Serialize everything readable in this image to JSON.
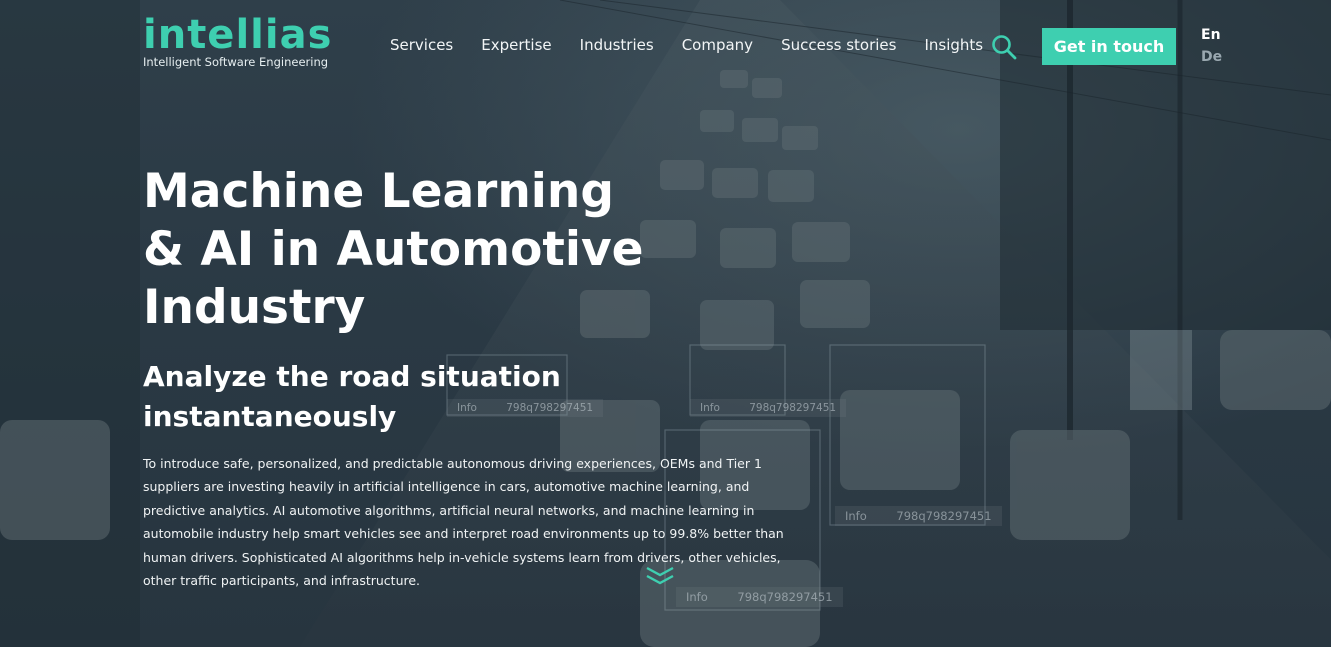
{
  "header": {
    "logo_word": "intellias",
    "logo_tagline": "Intelligent Software Engineering",
    "nav": [
      "Services",
      "Expertise",
      "Industries",
      "Company",
      "Success stories",
      "Insights"
    ],
    "search_icon": "search-icon",
    "cta_label": "Get in touch",
    "languages": {
      "active": "En",
      "inactive": "De"
    }
  },
  "hero": {
    "title_lines": [
      "Machine Learning",
      "& AI in Automotive",
      "Industry"
    ],
    "subtitle_lines": [
      "Analyze the road situation",
      "instantaneously"
    ],
    "body": "To introduce safe, personalized, and predictable autonomous driving experiences, OEMs and Tier 1 suppliers are investing heavily in artificial intelligence in cars, automotive machine learning, and predictive analytics. AI automotive algorithms, artificial neural networks, and machine learning in automobile industry help smart vehicles see and interpret road environments up to 99.8% better than human drivers. Sophisticated AI algorithms help in-vehicle systems learn from drivers, other vehicles, other traffic participants, and infrastructure.",
    "scroll_icon": "double-chevron-down-icon"
  },
  "detection_tags": [
    {
      "label": "Info",
      "value": "798q798297451"
    },
    {
      "label": "Info",
      "value": "798q798297451"
    },
    {
      "label": "Info",
      "value": "798q798297451"
    },
    {
      "label": "Info",
      "value": "798q798297451"
    }
  ],
  "colors": {
    "accent": "#3ecfb0",
    "overlay": "#2b3a45",
    "text": "#ffffff"
  }
}
